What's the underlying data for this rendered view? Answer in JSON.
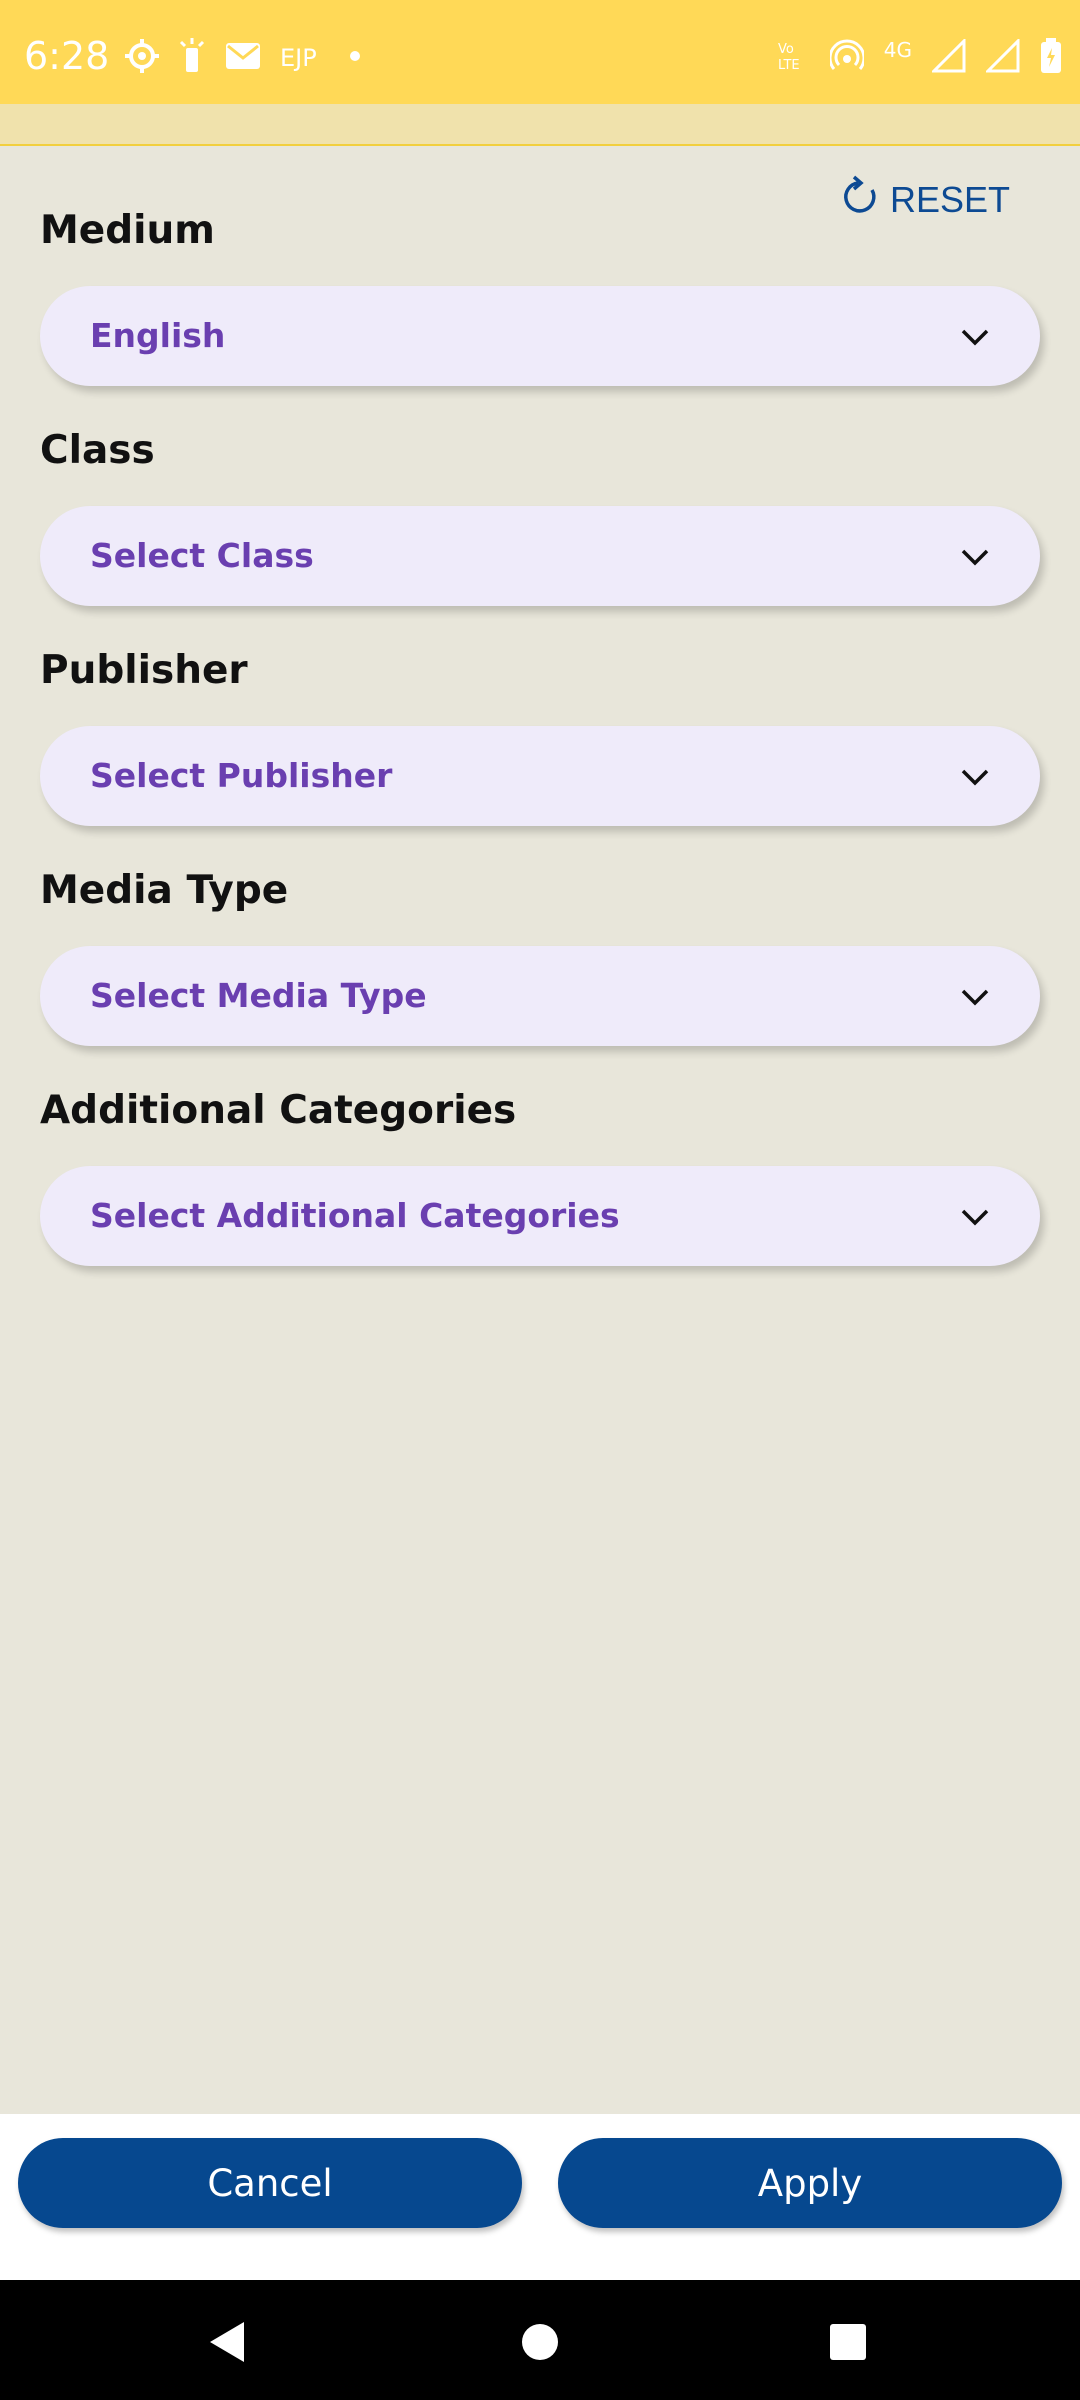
{
  "status_bar": {
    "time": "6:28",
    "carrier_text": "EJP",
    "network_label": "4G",
    "volte_label": "Vo LTE",
    "icons": [
      "settings-icon",
      "flashlight-icon",
      "mail-icon",
      "dot-icon",
      "volte-icon",
      "hotspot-icon",
      "signal-icon",
      "signal-icon",
      "battery-icon"
    ]
  },
  "filters": {
    "reset_label": "RESET",
    "medium": {
      "label": "Medium",
      "value": "English"
    },
    "class": {
      "label": "Class",
      "placeholder": "Select Class"
    },
    "publisher": {
      "label": "Publisher",
      "placeholder": "Select Publisher"
    },
    "media_type": {
      "label": "Media Type",
      "placeholder": "Select Media Type"
    },
    "additional_categories": {
      "label": "Additional Categories",
      "placeholder": "Select Additional Categories"
    }
  },
  "actions": {
    "cancel_label": "Cancel",
    "apply_label": "Apply"
  },
  "colors": {
    "status_bar": "#ffd957",
    "background": "#e8e6da",
    "dropdown_bg": "#efebfa",
    "dropdown_text": "#6a3fb0",
    "primary_button": "#06488f",
    "reset_text": "#0d4a93"
  },
  "nav": {
    "icons": [
      "back-icon",
      "home-icon",
      "recents-icon"
    ]
  }
}
